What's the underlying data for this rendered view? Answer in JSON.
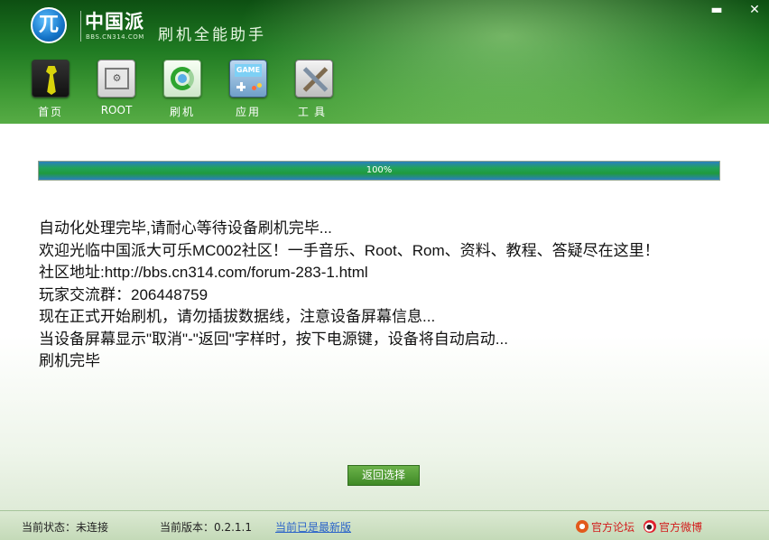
{
  "header": {
    "logo_glyph": "兀",
    "brand_name": "中国派",
    "brand_url": "BBS.CN314.COM",
    "app_title": "刷机全能助手",
    "window_controls": {
      "minimize": "▬",
      "close": "✕"
    }
  },
  "nav": [
    {
      "label": "首页",
      "icon": "home-tie-icon"
    },
    {
      "label": "ROOT",
      "icon": "root-box-icon"
    },
    {
      "label": "刷机",
      "icon": "flash-refresh-icon",
      "active": true
    },
    {
      "label": "应用",
      "icon": "game-app-icon",
      "icon_text": "GAME"
    },
    {
      "label": "工具",
      "icon": "tools-icon"
    }
  ],
  "progress": {
    "value": 1.0,
    "label": "100%"
  },
  "log": [
    "自动化处理完毕,请耐心等待设备刷机完毕...",
    "欢迎光临中国派大可乐MC002社区！一手音乐、Root、Rom、资料、教程、答疑尽在这里！",
    "社区地址:http://bbs.cn314.com/forum-283-1.html",
    "玩家交流群：206448759",
    "现在正式开始刷机，请勿插拔数据线，注意设备屏幕信息...",
    "当设备屏幕显示\"取消\"-\"返回\"字样时，按下电源键，设备将自动启动...",
    "刷机完毕"
  ],
  "back_button": "返回选择",
  "status": {
    "state": "当前状态：未连接",
    "version": "当前版本：0.2.1.1",
    "update_link": "当前已是最新版",
    "forum_link": "官方论坛",
    "weibo_link": "官方微博"
  },
  "colors": {
    "header_dark": "#0d4f12",
    "header_light": "#57ac45",
    "progress_fill": "#1f9a3d",
    "link": "#2a63c9",
    "status_red": "#d21b1b"
  }
}
